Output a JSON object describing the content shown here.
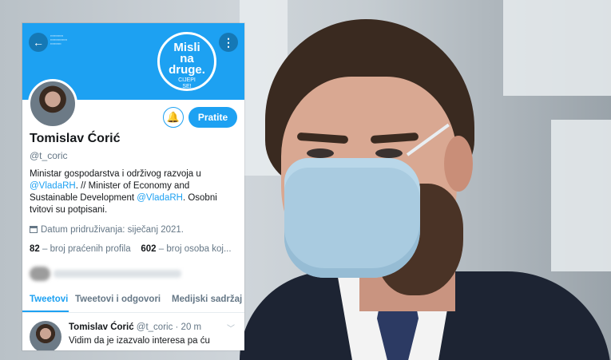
{
  "profile": {
    "back_icon": "arrow-left-icon",
    "more_icon": "more-vertical-icon",
    "campaign": {
      "line1": "Misli",
      "line2": "na",
      "line3": "druge.",
      "line4": "CIJEPI",
      "line5": "SE!"
    },
    "notify_icon": "bell-plus-icon",
    "follow_label": "Pratite",
    "display_name": "Tomislav Ćorić",
    "handle": "@t_coric",
    "bio_part1": "Ministar gospodarstva i održivog razvoja u ",
    "bio_mention1": "@VladaRH",
    "bio_part2": ". // Minister of Economy and Sustainable Development ",
    "bio_mention2": "@VladaRH",
    "bio_part3": ". Osobni tvitovi su potpisani.",
    "joined": "Datum pridruživanja: siječanj 2021.",
    "following_count": "82",
    "following_label": "– broj praćenih profila",
    "followers_count": "602",
    "followers_label": "– broj osoba koj..."
  },
  "tabs": [
    {
      "label": "Tweetovi"
    },
    {
      "label": "Tweetovi i odgovori"
    },
    {
      "label": "Medijski sadržaj"
    }
  ],
  "tweet": {
    "author": "Tomislav Ćorić",
    "meta": "@t_coric · 20 m",
    "text": "Vidim da je izazvalo interesa pa ću"
  },
  "colors": {
    "accent": "#1da1f2",
    "text": "#14171a",
    "muted": "#657786"
  }
}
